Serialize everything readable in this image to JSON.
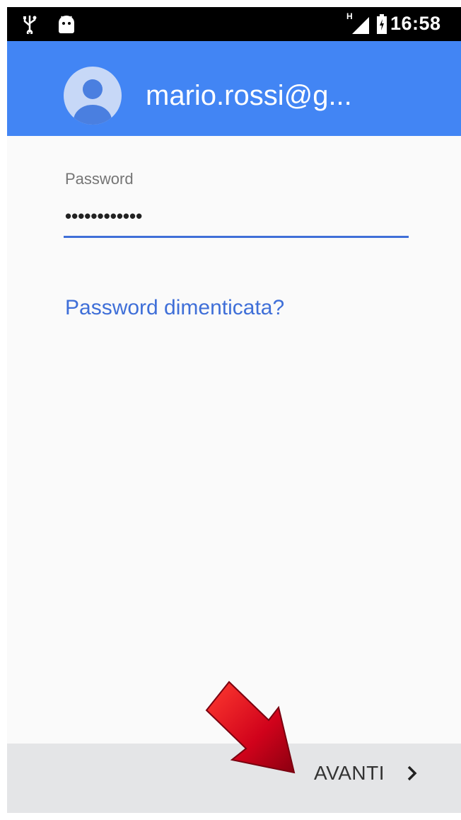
{
  "status_bar": {
    "network_type": "H",
    "time": "16:58",
    "icons": [
      "usb-icon",
      "android-icon",
      "signal-icon",
      "battery-icon"
    ]
  },
  "header": {
    "account": "mario.rossi@g...",
    "avatar_icon": "account-avatar-icon",
    "background_color": "#4285f4"
  },
  "password": {
    "label": "Password",
    "value": "••••••••••••",
    "accent_color": "#3f6fd8"
  },
  "forgot_link": "Password dimenticata?",
  "footer": {
    "next_label": "AVANTI",
    "next_icon": "chevron-right-icon"
  },
  "annotation": {
    "icon": "red-arrow-icon",
    "color": "#d0021b"
  }
}
